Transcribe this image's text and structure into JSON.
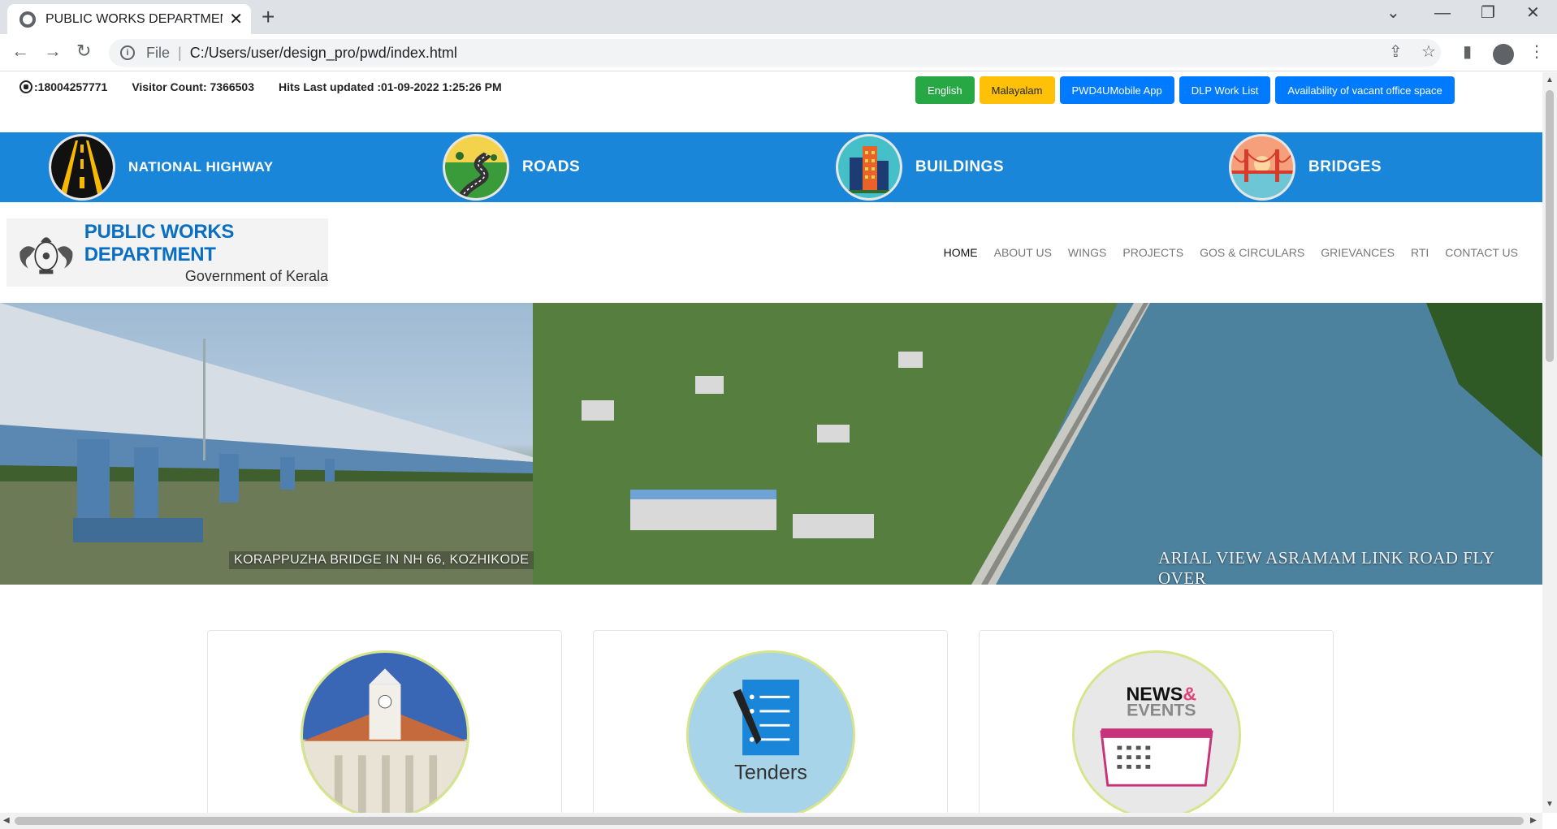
{
  "browser": {
    "tab_title": "PUBLIC WORKS DEPARTMENT| G",
    "url_scheme": "File",
    "url": "C:/Users/user/design_pro/pwd/index.html"
  },
  "topinfo": {
    "phone": ":18004257771",
    "visitor_count": "Visitor Count: 7366503",
    "hits_updated": "Hits Last updated :01-09-2022 1:25:26 PM"
  },
  "toplinks": [
    {
      "label": "English",
      "color": "#28a745"
    },
    {
      "label": "Malayalam",
      "color": "#ffc107"
    },
    {
      "label": "PWD4UMobile App",
      "color": "#007bff"
    },
    {
      "label": "DLP Work List",
      "color": "#007bff"
    },
    {
      "label": "Availability of vacant office space",
      "color": "#007bff"
    }
  ],
  "categories": [
    {
      "label": "NATIONAL HIGHWAY",
      "icon": "highway-icon"
    },
    {
      "label": "ROADS",
      "icon": "road-icon"
    },
    {
      "label": "BUILDINGS",
      "icon": "buildings-icon"
    },
    {
      "label": "BRIDGES",
      "icon": "bridge-icon"
    }
  ],
  "logo": {
    "title": "PUBLIC WORKS DEPARTMENT",
    "subtitle": "Government of Kerala"
  },
  "nav": [
    {
      "label": "HOME",
      "active": true
    },
    {
      "label": "ABOUT US"
    },
    {
      "label": "WINGS"
    },
    {
      "label": "PROJECTS"
    },
    {
      "label": "GOS & CIRCULARS"
    },
    {
      "label": "GRIEVANCES"
    },
    {
      "label": "RTI"
    },
    {
      "label": "CONTACT US"
    }
  ],
  "banner": {
    "left_caption": "KORAPPUZHA BRIDGE IN NH 66, KOZHIKODE",
    "right_caption": "ARIAL VIEW ASRAMAM LINK ROAD FLY OVER"
  },
  "cards": [
    {
      "name": "secretariat-card",
      "image_text": ""
    },
    {
      "name": "tenders-card",
      "image_text": "Tenders"
    },
    {
      "name": "news-events-card",
      "image_text": "NEWS& EVENTS"
    }
  ],
  "colors": {
    "category_bar": "#1a86d9",
    "brand_blue": "#0a6fc2"
  }
}
